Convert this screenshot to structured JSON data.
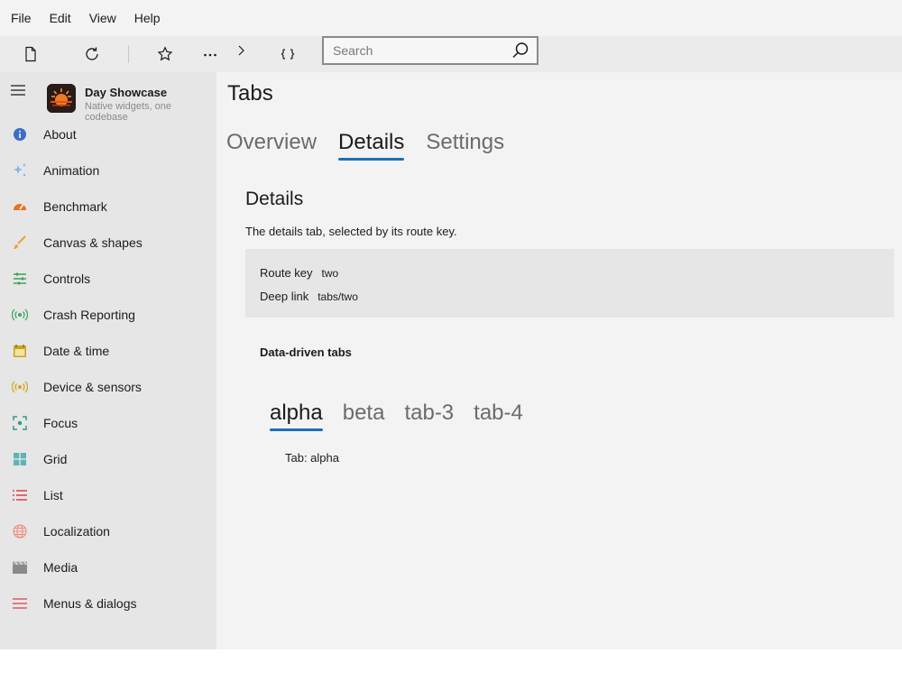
{
  "menubar": {
    "items": [
      {
        "label": "File"
      },
      {
        "label": "Edit"
      },
      {
        "label": "View"
      },
      {
        "label": "Help"
      }
    ]
  },
  "toolbar": {
    "buttons": [
      {
        "icon": "new-document-icon"
      },
      {
        "icon": "refresh-icon"
      },
      {
        "icon": "star-icon"
      },
      {
        "icon": "more-icon"
      },
      {
        "icon": "chevron-right-icon"
      },
      {
        "icon": "braces-icon"
      }
    ],
    "search": {
      "placeholder": "Search",
      "value": ""
    }
  },
  "sidebar": {
    "app_title": "Day Showcase",
    "app_subtitle": "Native widgets, one codebase",
    "items": [
      {
        "label": "About",
        "icon": "info-icon",
        "color": "#3a6fc4"
      },
      {
        "label": "Animation",
        "icon": "sparkle-icon",
        "color": "#7fb6e8"
      },
      {
        "label": "Benchmark",
        "icon": "speedometer-icon",
        "color": "#e8731f"
      },
      {
        "label": "Canvas & shapes",
        "icon": "brush-icon",
        "color": "#f0a030"
      },
      {
        "label": "Controls",
        "icon": "sliders-icon",
        "color": "#3aa05a"
      },
      {
        "label": "Crash Reporting",
        "icon": "broadcast-icon",
        "color": "#44a86a"
      },
      {
        "label": "Date & time",
        "icon": "calendar-icon",
        "color": "#c9a227"
      },
      {
        "label": "Device & sensors",
        "icon": "sensor-icon",
        "color": "#d4a82a"
      },
      {
        "label": "Focus",
        "icon": "focus-icon",
        "color": "#2e9a8a"
      },
      {
        "label": "Grid",
        "icon": "grid-icon",
        "color": "#5fb3b8"
      },
      {
        "label": "List",
        "icon": "list-icon",
        "color": "#d8404a"
      },
      {
        "label": "Localization",
        "icon": "globe-icon",
        "color": "#ef8a7a"
      },
      {
        "label": "Media",
        "icon": "clapperboard-icon",
        "color": "#8a8a8a"
      },
      {
        "label": "Menus & dialogs",
        "icon": "menu-lines-icon",
        "color": "#d85a6a"
      }
    ]
  },
  "main": {
    "title": "Tabs",
    "tabs": [
      {
        "label": "Overview",
        "selected": false
      },
      {
        "label": "Details",
        "selected": true
      },
      {
        "label": "Settings",
        "selected": false
      }
    ],
    "section_title": "Details",
    "section_desc": "The details tab, selected by its route key.",
    "kv": [
      {
        "key": "Route key",
        "value": "two"
      },
      {
        "key": "Deep link",
        "value": "tabs/two"
      }
    ],
    "data_driven_title": "Data-driven tabs",
    "dd_tabs": [
      {
        "label": "alpha",
        "selected": true
      },
      {
        "label": "beta",
        "selected": false
      },
      {
        "label": "tab-3",
        "selected": false
      },
      {
        "label": "tab-4",
        "selected": false
      }
    ],
    "dd_content": "Tab: alpha"
  }
}
